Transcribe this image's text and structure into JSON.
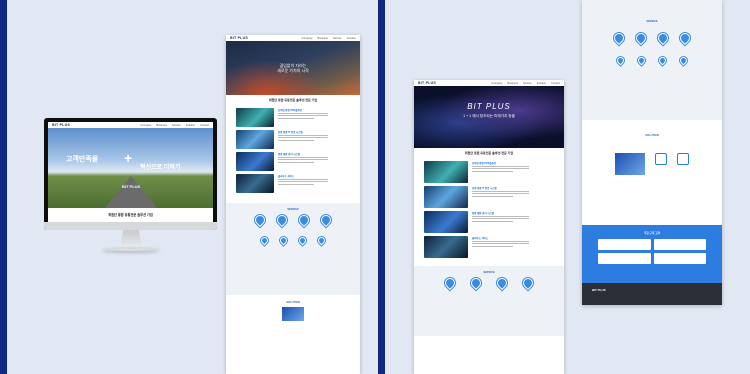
{
  "brand": "BIT PLUS",
  "menu": [
    "Company",
    "Business",
    "Service",
    "Solution",
    "Contact"
  ],
  "monitor": {
    "headline_left": "고객만족을",
    "headline_right": "혁신으로 더하기",
    "caption": "최첨단 통합 유통전문 솔루션 기업"
  },
  "left_page": {
    "hero_line1": "끊임없이 자라는",
    "hero_line2": "새로운 가치의 시작",
    "section_title": "최첨단 통합 유통전문 솔루션 전문 기업",
    "items": [
      "모바일 통합 POS솔루션",
      "유통 통합 IT 전문 시스템",
      "통합 매장 관리 시스템",
      "클라우드 서비스"
    ],
    "service_title": "SERVICE",
    "solution_title": "SOLUTION"
  },
  "right_page": {
    "hero_title": "BIT PLUS",
    "hero_sub": "1 + 1 에서 창조되는 미래가치 창출",
    "section_title": "최첨단 통합 유통전문 솔루션 전문 기업",
    "service_title": "SERVICE",
    "solution_title": "SOLUTION",
    "brand_title": "주요 구축 고객"
  },
  "colors": {
    "outer_bg": "#0f2a7e",
    "panel_bg": "#e2e8f3",
    "accent": "#2d7de0"
  }
}
